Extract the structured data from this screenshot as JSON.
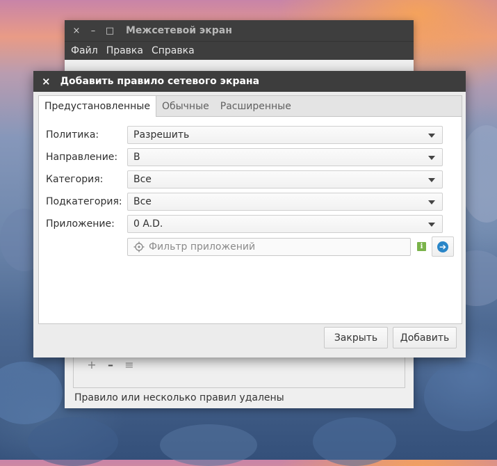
{
  "main_window": {
    "title": "Межсетевой экран",
    "controls": {
      "close": "×",
      "minimize": "–",
      "maximize": "□"
    },
    "menu": [
      "Файл",
      "Правка",
      "Справка"
    ],
    "toolbar": {
      "add": "+",
      "remove": "–",
      "edit": "≡"
    },
    "status": "Правило или несколько правил удалены"
  },
  "dialog": {
    "title": "Добавить правило сетевого экрана",
    "close": "×",
    "tabs": [
      "Предустановленные",
      "Обычные",
      "Расширенные"
    ],
    "active_tab": "Предустановленные",
    "fields": {
      "policy": {
        "label": "Политика:",
        "value": "Разрешить"
      },
      "direction": {
        "label": "Направление:",
        "value": "В"
      },
      "category": {
        "label": "Категория:",
        "value": "Все"
      },
      "subcategory": {
        "label": "Подкатегория:",
        "value": "Все"
      },
      "application": {
        "label": "Приложение:",
        "value": "0 A.D."
      }
    },
    "filter": {
      "placeholder": "Фильтр приложений",
      "value": ""
    },
    "buttons": {
      "close": "Закрыть",
      "add": "Добавить"
    }
  },
  "icons": {
    "filter": "crosshair-icon",
    "info": "info-icon",
    "go": "arrow-right-circle-icon"
  },
  "colors": {
    "titlebar": "#3d3d3d",
    "info_icon": "#7ab34a",
    "go_button": "#2a86c8"
  }
}
